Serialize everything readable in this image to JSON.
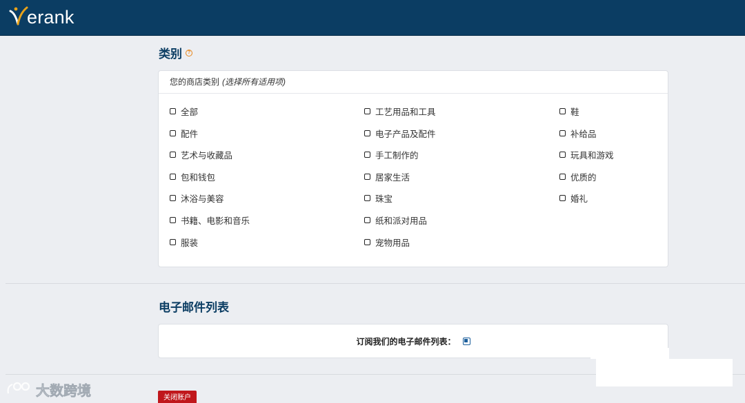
{
  "brand": {
    "logo_text": "erank"
  },
  "category_section": {
    "title": "类别",
    "card_header_label": "您的商店类别",
    "card_header_hint": "(选择所有适用项)",
    "columns": [
      [
        "全部",
        "配件",
        "艺术与收藏品",
        "包和钱包",
        "沐浴与美容",
        "书籍、电影和音乐",
        "服装"
      ],
      [
        "工艺用品和工具",
        "电子产品及配件",
        "手工制作的",
        "居家生活",
        "珠宝",
        "纸和派对用品",
        "宠物用品"
      ],
      [
        "鞋",
        "补给品",
        "玩具和游戏",
        "优质的",
        "婚礼"
      ]
    ]
  },
  "email_section": {
    "title": "电子邮件列表",
    "subscribe_label": "订阅我们的电子邮件列表：",
    "subscribed": true
  },
  "close_account_button": "关闭账户",
  "watermark_text": "大数跨境"
}
